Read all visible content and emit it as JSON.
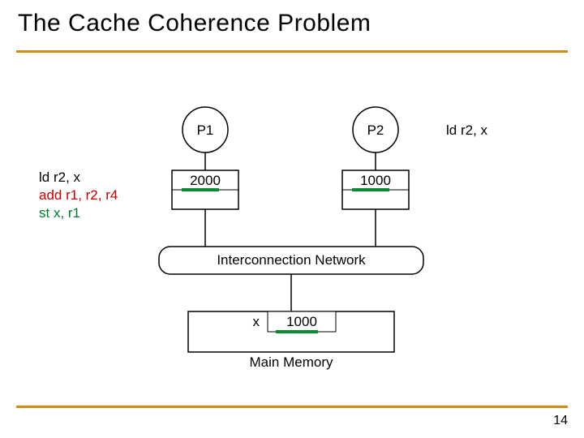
{
  "title": "The Cache Coherence Problem",
  "page_number": "14",
  "processors": {
    "p1": "P1",
    "p2": "P2"
  },
  "caches": {
    "c1": "2000",
    "c2": "1000"
  },
  "interconnect": "Interconnection Network",
  "memory": {
    "varname": "x",
    "value": "1000"
  },
  "main_memory_label": "Main Memory",
  "p2_annot": "ld r2, x",
  "p1_code": {
    "line1": "ld r2, x",
    "line2": "add r1, r2, r4",
    "line3": "st x, r1"
  }
}
